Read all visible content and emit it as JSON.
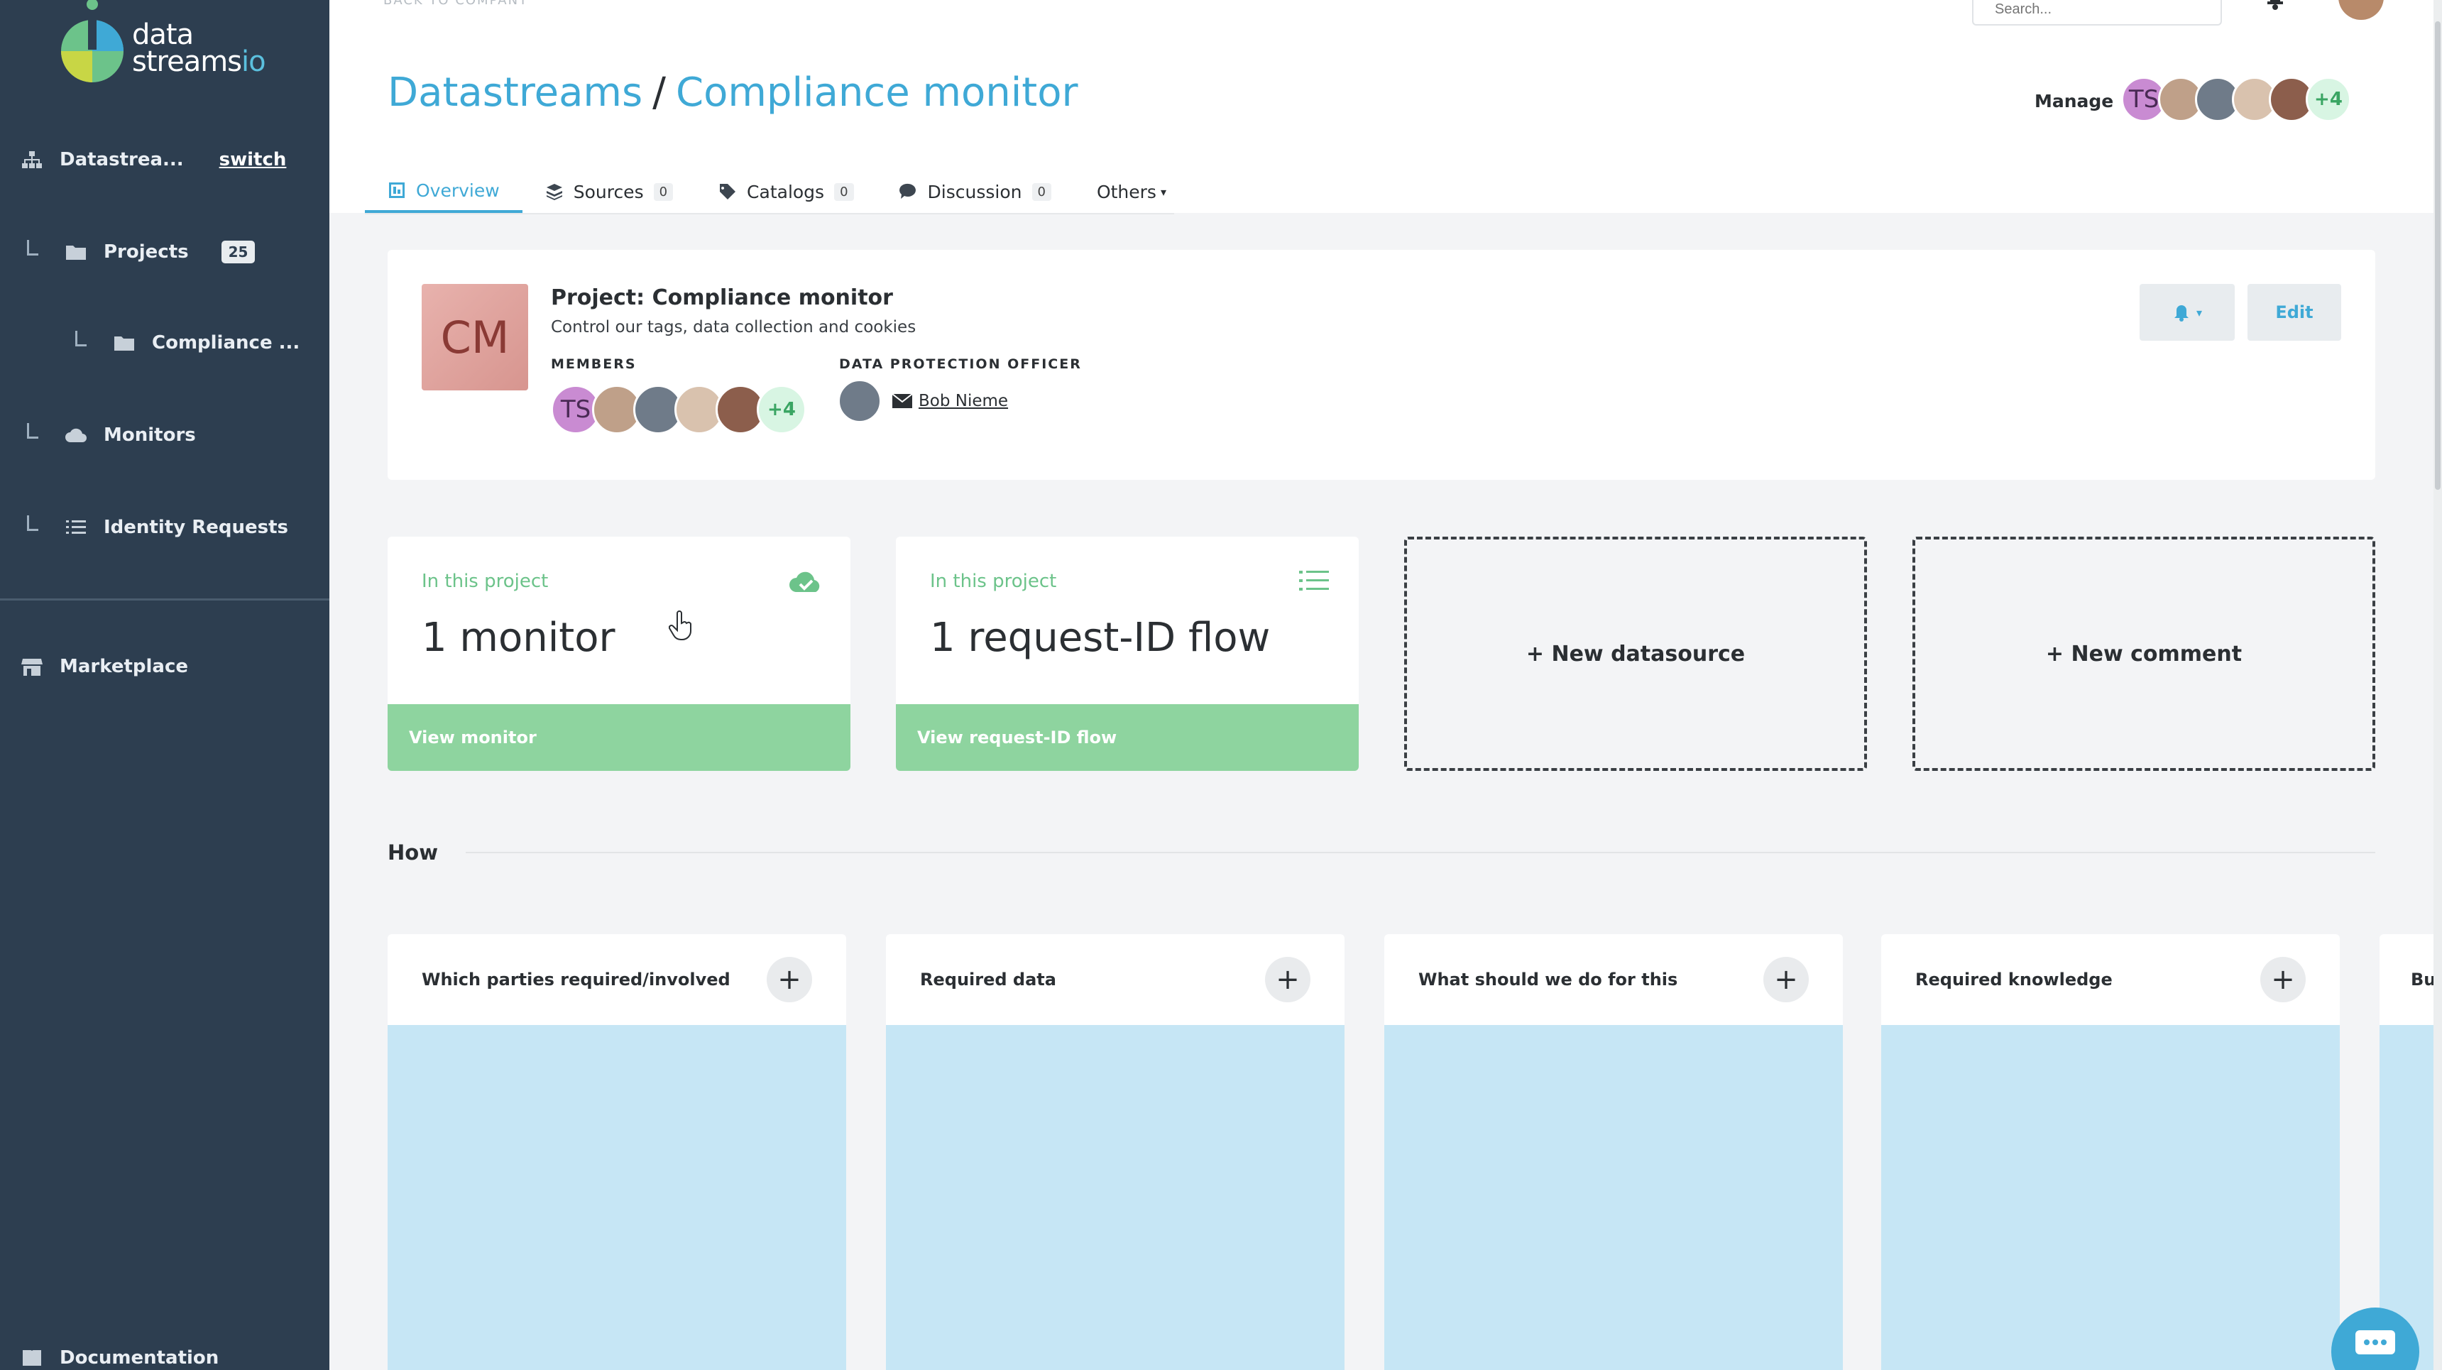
{
  "app": {
    "logo_line1": "data",
    "logo_line2": "streams",
    "logo_suffix": "io"
  },
  "sidebar": {
    "workspace_label": "Datastrea...",
    "switch_label": "switch",
    "items": [
      {
        "label": "Projects",
        "badge": "25",
        "icon": "folder-icon"
      },
      {
        "label": "Compliance ...",
        "icon": "folder-icon"
      },
      {
        "label": "Monitors",
        "icon": "cloud-icon"
      },
      {
        "label": "Identity Requests",
        "icon": "list-icon"
      },
      {
        "label": "Marketplace",
        "icon": "store-icon"
      },
      {
        "label": "Documentation",
        "icon": "book-icon"
      }
    ]
  },
  "header": {
    "back_label": "BACK TO COMPANY",
    "search_placeholder": "Search...",
    "breadcrumb_root": "Datastreams",
    "breadcrumb_sep": "/",
    "breadcrumb_current": "Compliance monitor",
    "manage_label": "Manage",
    "avatar_initials": "TS",
    "avatar_more": "+4"
  },
  "tabs": [
    {
      "label": "Overview",
      "active": true
    },
    {
      "label": "Sources",
      "count": "0"
    },
    {
      "label": "Catalogs",
      "count": "0"
    },
    {
      "label": "Discussion",
      "count": "0"
    },
    {
      "label": "Others"
    }
  ],
  "project": {
    "tile_initials": "CM",
    "title": "Project: Compliance monitor",
    "description": "Control our tags, data collection and cookies",
    "members_label": "MEMBERS",
    "members_initials": "TS",
    "members_more": "+4",
    "officer_label": "DATA PROTECTION OFFICER",
    "officer_name": "Bob Nieme",
    "edit_label": "Edit"
  },
  "stats": [
    {
      "label": "In this project",
      "value": "1 monitor",
      "action": "View monitor",
      "icon": "cloud-check-icon"
    },
    {
      "label": "In this project",
      "value": "1 request-ID flow",
      "action": "View request-ID flow",
      "icon": "list-icon"
    }
  ],
  "actions": {
    "new_datasource": "+ New datasource",
    "new_comment": "+ New comment"
  },
  "how": {
    "title": "How",
    "columns": [
      {
        "label": "Which parties required/involved"
      },
      {
        "label": "Required data"
      },
      {
        "label": "What should we do for this"
      },
      {
        "label": "Required knowledge"
      },
      {
        "label": "Bu"
      }
    ],
    "add_symbol": "+"
  },
  "colors": {
    "accent": "#3fa9d6",
    "sidebar": "#2d3e50",
    "success": "#8ed49f",
    "column_body": "#c6e6f5"
  }
}
